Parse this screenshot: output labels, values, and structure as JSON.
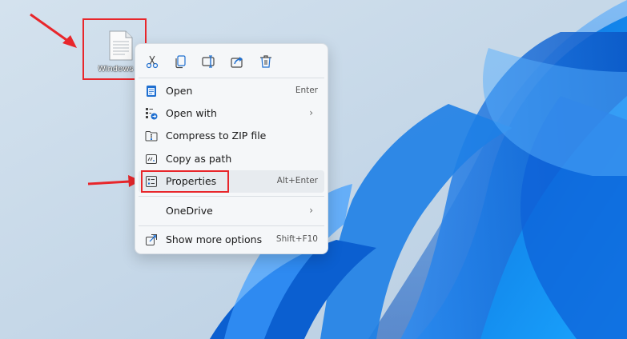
{
  "desktop": {
    "file_label": "Windows"
  },
  "context_menu": {
    "toolbar": [
      {
        "icon": "cut-icon",
        "label": "Cut"
      },
      {
        "icon": "copy-icon",
        "label": "Copy"
      },
      {
        "icon": "rename-icon",
        "label": "Rename"
      },
      {
        "icon": "share-icon",
        "label": "Share"
      },
      {
        "icon": "delete-icon",
        "label": "Delete"
      }
    ],
    "items": [
      {
        "label": "Open",
        "shortcut": "Enter",
        "icon": "notepad-icon"
      },
      {
        "label": "Open with",
        "shortcut": "",
        "icon": "open-with-icon",
        "submenu": true
      },
      {
        "label": "Compress to ZIP file",
        "shortcut": "",
        "icon": "zip-folder-icon"
      },
      {
        "label": "Copy as path",
        "shortcut": "",
        "icon": "copy-path-icon"
      },
      {
        "label": "Properties",
        "shortcut": "Alt+Enter",
        "icon": "properties-icon"
      },
      {
        "label": "OneDrive",
        "shortcut": "",
        "icon": "",
        "submenu": true
      },
      {
        "label": "Show more options",
        "shortcut": "Shift+F10",
        "icon": "more-options-icon"
      }
    ],
    "chevron": "›"
  },
  "colors": {
    "annotation_red": "#e8262b",
    "accent_blue": "#1f6fd0"
  }
}
